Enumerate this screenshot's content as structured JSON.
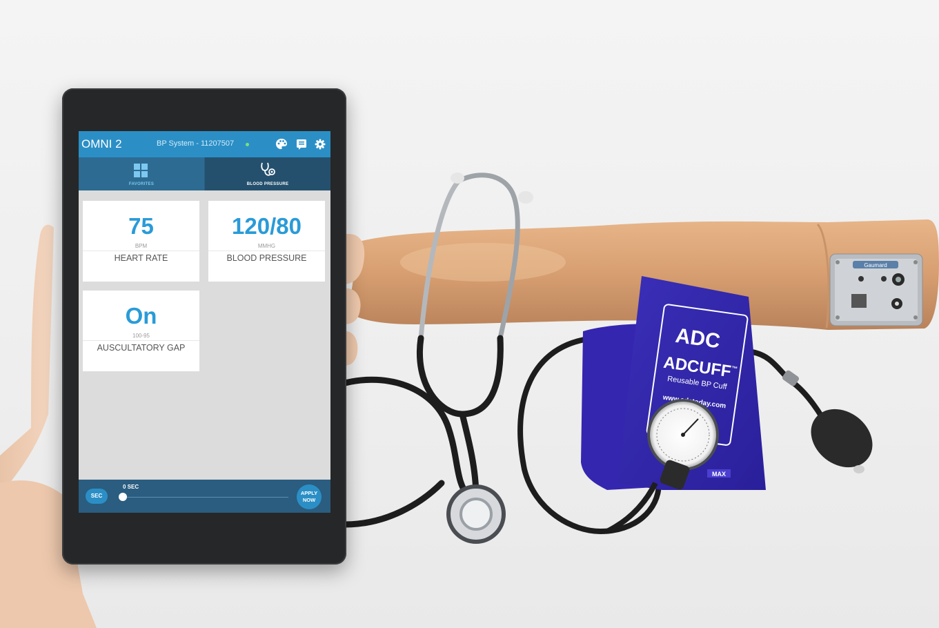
{
  "app": {
    "brand": "OMNI 2",
    "system_label": "BP System - 11207507",
    "status_color": "#7be07b",
    "accent_color": "#2b8fc6",
    "header_icons": [
      "palette-icon",
      "notes-icon",
      "settings-icon"
    ]
  },
  "tabs": [
    {
      "label": "FAVORITES",
      "icon": "grid-icon",
      "active": true
    },
    {
      "label": "BLOOD PRESSURE",
      "icon": "stethoscope-icon",
      "active": false
    }
  ],
  "tiles": [
    {
      "value": "75",
      "unit": "BPM",
      "name": "HEART RATE"
    },
    {
      "value": "120/80",
      "unit": "MMHG",
      "name": "BLOOD PRESSURE"
    },
    {
      "value": "On",
      "unit": "100-95",
      "name": "AUSCULTATORY GAP"
    }
  ],
  "bottom": {
    "sec_button": "SEC",
    "slider_label": "0 SEC",
    "slider_value": 0,
    "apply_line1": "APPLY",
    "apply_line2": "NOW"
  },
  "product": {
    "cuff_brand": "ADC",
    "cuff_name": "ADCUFF",
    "cuff_tm": "™",
    "cuff_sub": "Reusable BP Cuff",
    "cuff_url": "www.adctoday.com",
    "cuff_size_mark": "MAX",
    "module_brand": "Gaumard"
  }
}
